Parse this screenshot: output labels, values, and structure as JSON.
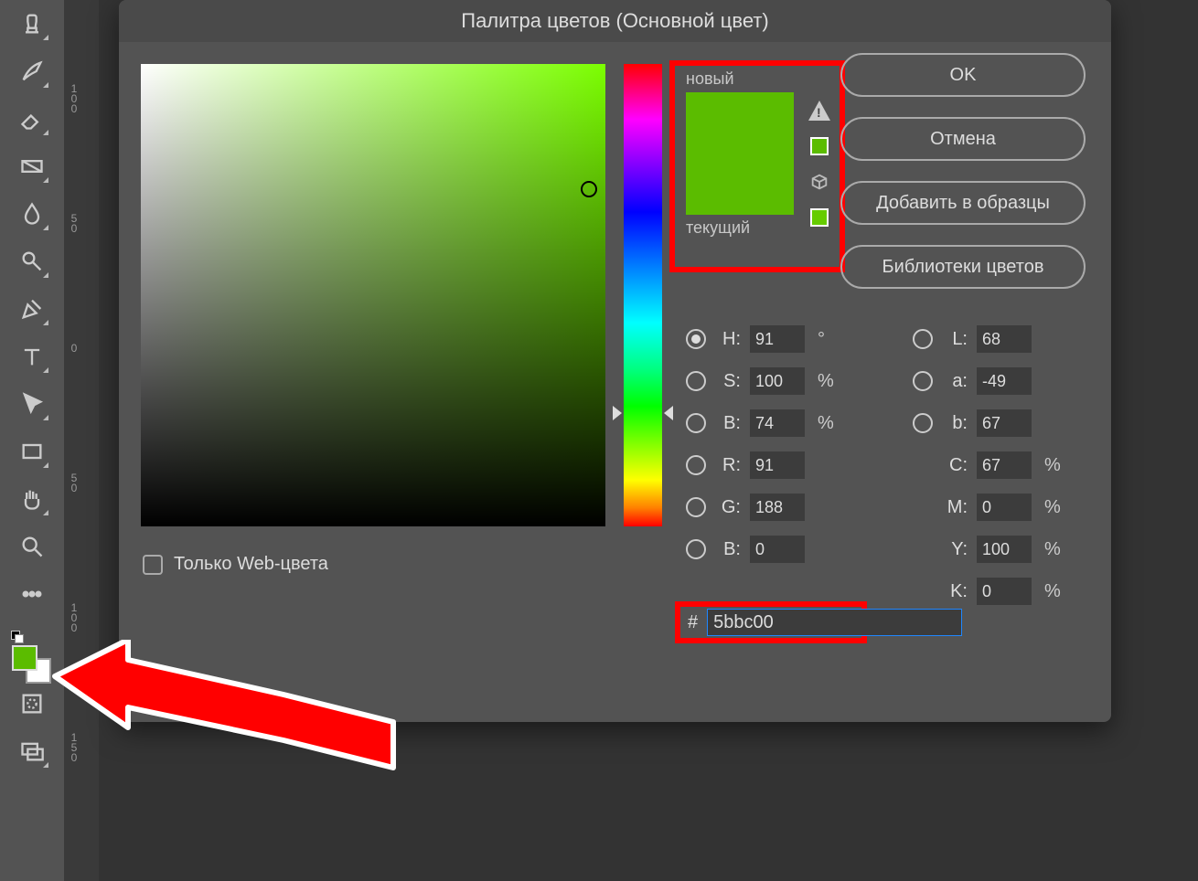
{
  "dialog": {
    "title": "Палитра цветов (Основной цвет)",
    "preview": {
      "new_label": "новый",
      "current_label": "текущий",
      "swatch": "#5bbc00"
    },
    "buttons": {
      "ok": "OK",
      "cancel": "Отмена",
      "add": "Добавить в образцы",
      "libraries": "Библиотеки цветов"
    },
    "web_only_label": "Только Web-цвета",
    "hex_label": "#",
    "hex_value": "5bbc00",
    "hsb": {
      "h_label": "H:",
      "h": "91",
      "h_unit": "°",
      "s_label": "S:",
      "s": "100",
      "s_unit": "%",
      "b_label": "B:",
      "b": "74",
      "b_unit": "%"
    },
    "rgb": {
      "r_label": "R:",
      "r": "91",
      "g_label": "G:",
      "g": "188",
      "b_label": "B:",
      "b": "0"
    },
    "lab": {
      "l_label": "L:",
      "l": "68",
      "a_label": "a:",
      "a": "-49",
      "b_label": "b:",
      "b": "67"
    },
    "cmyk": {
      "c_label": "C:",
      "c": "67",
      "m_label": "M:",
      "m": "0",
      "y_label": "Y:",
      "y": "100",
      "k_label": "K:",
      "k": "0",
      "unit": "%"
    }
  },
  "ruler": {
    "t1": "100",
    "t2": "50",
    "t3": "0",
    "t4": "50",
    "t5": "100",
    "t6": "150"
  },
  "colors": {
    "foreground": "#5bbc00",
    "background": "#ffffff"
  }
}
